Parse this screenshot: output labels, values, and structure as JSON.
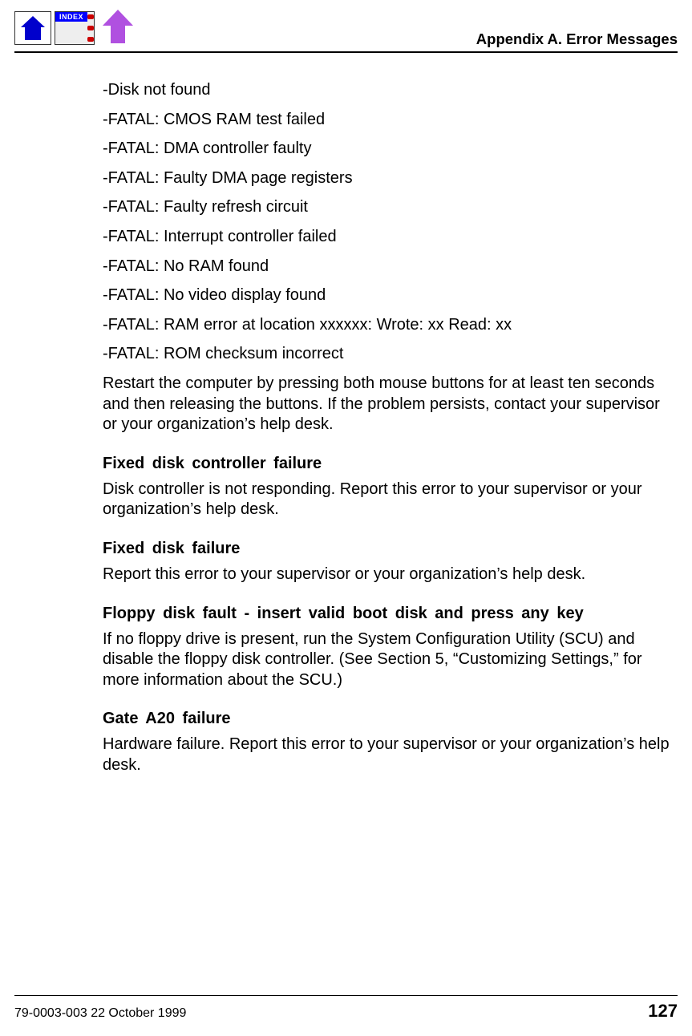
{
  "nav": {
    "index_label": "INDEX"
  },
  "header": {
    "appendix": "Appendix A.  Error Messages"
  },
  "errors": [
    "-Disk not found",
    "-FATAL: CMOS RAM test failed",
    "-FATAL: DMA controller faulty",
    "-FATAL: Faulty DMA page registers",
    "-FATAL: Faulty refresh circuit",
    "-FATAL: Interrupt controller failed",
    "-FATAL: No RAM found",
    "-FATAL: No video display found",
    "-FATAL: RAM error at location xxxxxx: Wrote: xx Read: xx",
    "-FATAL: ROM checksum incorrect"
  ],
  "restart_note": "Restart the computer by pressing both mouse buttons for at least ten seconds and then releasing the buttons. If the problem persists, contact your supervisor or your organization’s help desk.",
  "sections": [
    {
      "heading": "Fixed disk controller failure",
      "body": "Disk controller is not responding. Report this error to your supervisor or your organization’s help desk."
    },
    {
      "heading": "Fixed disk failure",
      "body": "Report this error to your supervisor or your organization’s help desk."
    },
    {
      "heading": "Floppy disk fault - insert valid boot disk and press any key",
      "body": "If no floppy drive is present, run the System Configuration Utility (SCU) and disable the floppy disk controller. (See Section 5, “Customizing Settings,” for more information about the SCU.)"
    },
    {
      "heading": "Gate A20 failure",
      "body": "Hardware failure. Report this error to your supervisor or your organization’s help desk."
    }
  ],
  "footer": {
    "doc_id": "79-0003-003   22 October 1999",
    "page_number": "127"
  }
}
